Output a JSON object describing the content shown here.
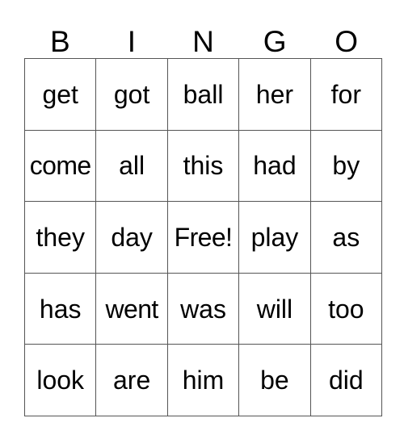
{
  "card": {
    "title_letters": [
      "B",
      "I",
      "N",
      "G",
      "O"
    ],
    "free_space_label": "Free!",
    "border_color": "#555555",
    "text_color": "#000000",
    "background_color": "#ffffff",
    "rows": [
      [
        "get",
        "got",
        "ball",
        "her",
        "for"
      ],
      [
        "come",
        "all",
        "this",
        "had",
        "by"
      ],
      [
        "they",
        "day",
        "Free!",
        "play",
        "as"
      ],
      [
        "has",
        "went",
        "was",
        "will",
        "too"
      ],
      [
        "look",
        "are",
        "him",
        "be",
        "did"
      ]
    ]
  }
}
